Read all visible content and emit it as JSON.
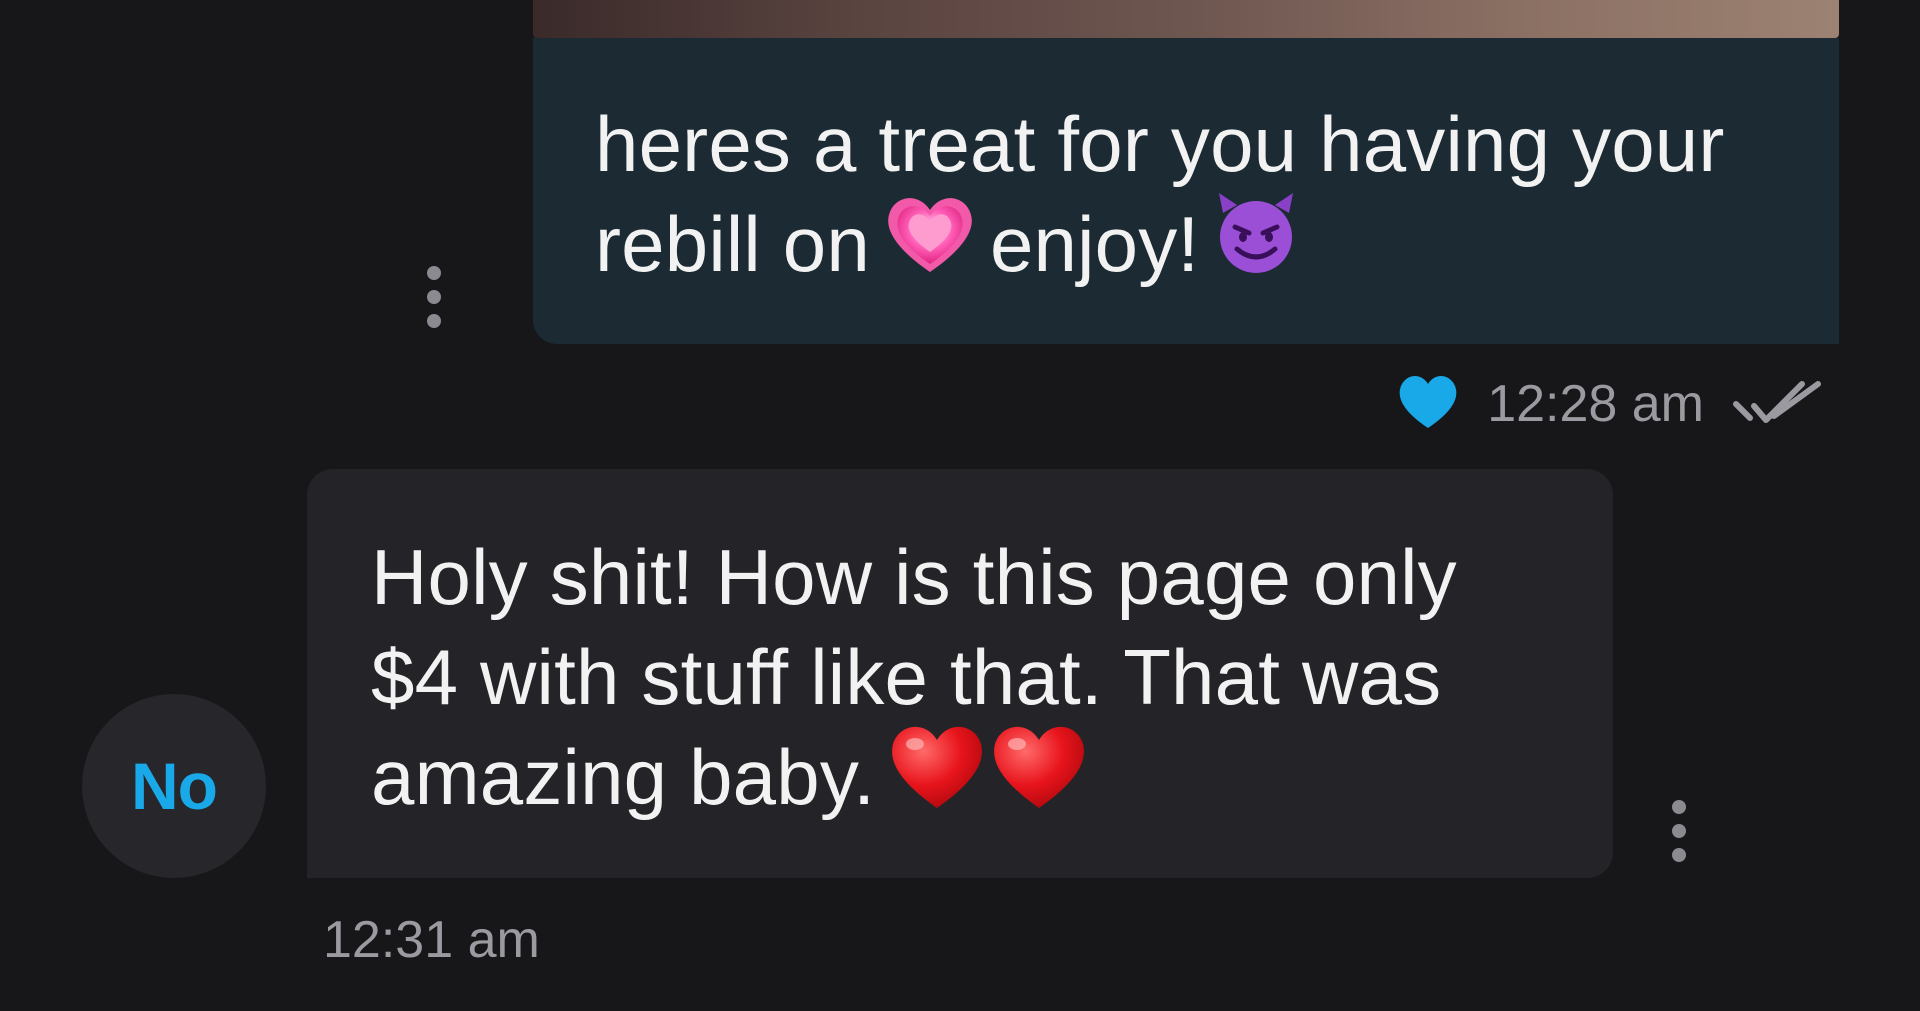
{
  "outgoing_message": {
    "text_line1": "heres a treat for you having your",
    "text_line2a": "rebill on",
    "text_line2b": "enjoy!",
    "emoji1": "growing-heart-icon",
    "emoji2": "smiling-devil-icon",
    "time": "12:28 am",
    "liked": true,
    "read_status": "double-check-icon"
  },
  "incoming_message": {
    "text_line1": "Holy shit! How is this page only",
    "text_line2": "$4 with stuff like that. That was",
    "text_line3": "amazing baby.",
    "emoji": "red-heart-icon",
    "time": "12:31 am"
  },
  "sender": {
    "avatar_initials": "No"
  },
  "colors": {
    "background": "#17171a",
    "outgoing_bubble": "#1b2a33",
    "incoming_bubble": "#242428",
    "accent": "#19a8e8",
    "timestamp": "#9a9aa0"
  }
}
